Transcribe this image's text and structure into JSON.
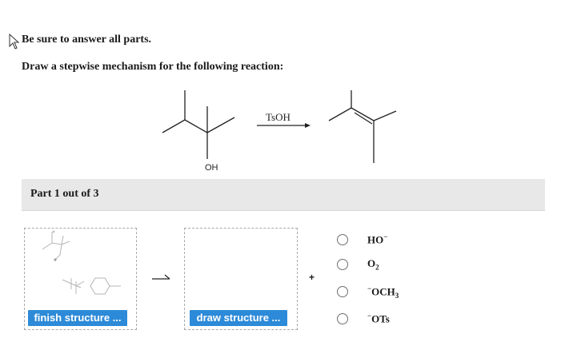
{
  "header": {
    "instruction": "Be sure to answer all parts.",
    "question": "Draw a stepwise mechanism for the following reaction:"
  },
  "reaction": {
    "reagent": "TsOH",
    "substituent": "OH"
  },
  "part": {
    "label": "Part 1 out of 3"
  },
  "workspace": {
    "finish_button": "finish structure ...",
    "draw_button": "draw structure ...",
    "plus": "+"
  },
  "options": [
    {
      "base": "HO",
      "sup": "−",
      "sub": ""
    },
    {
      "base": "O",
      "sup": "",
      "sub": "2"
    },
    {
      "pre": "−",
      "base": "OCH",
      "sub": "3"
    },
    {
      "pre": "−",
      "base": "OTs",
      "sub": ""
    }
  ]
}
